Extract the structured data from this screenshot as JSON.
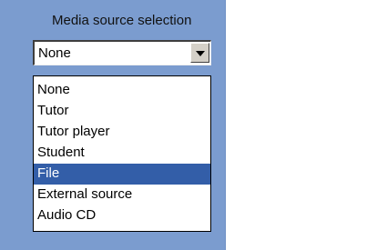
{
  "panel": {
    "title": "Media source selection"
  },
  "combo": {
    "selected": "None",
    "button_icon": "chevron-down-icon"
  },
  "dropdown": {
    "items": [
      {
        "label": "None",
        "selected": false
      },
      {
        "label": "Tutor",
        "selected": false
      },
      {
        "label": "Tutor player",
        "selected": false
      },
      {
        "label": "Student",
        "selected": false
      },
      {
        "label": "File",
        "selected": true
      },
      {
        "label": "External source",
        "selected": false
      },
      {
        "label": "Audio CD",
        "selected": false
      }
    ]
  },
  "colors": {
    "panel_bg": "#7b9ccf",
    "highlight": "#335ea8"
  }
}
